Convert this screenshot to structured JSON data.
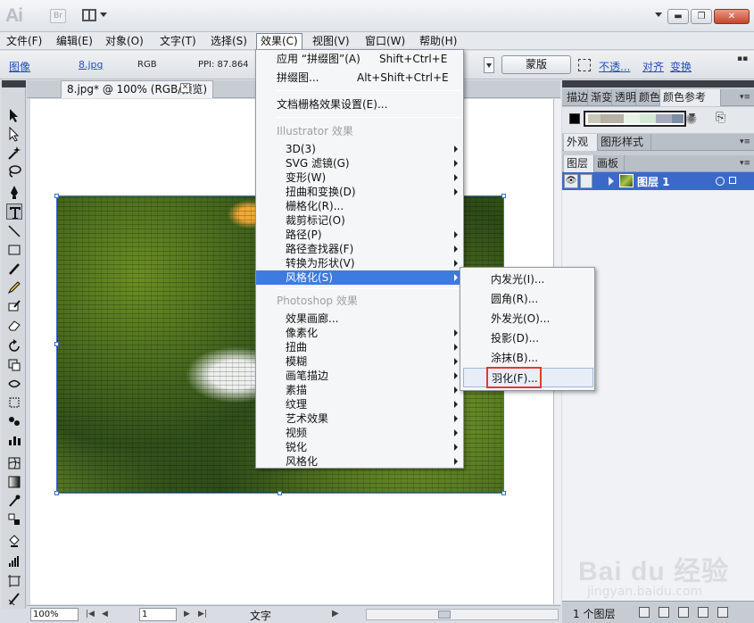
{
  "app": {
    "logo": "Ai",
    "bridge_label": "Br"
  },
  "window_controls": {
    "minimize": "▬",
    "restore": "❐",
    "close": "✕"
  },
  "menubar": {
    "items": [
      {
        "label": "文件(F)"
      },
      {
        "label": "编辑(E)"
      },
      {
        "label": "对象(O)"
      },
      {
        "label": "文字(T)"
      },
      {
        "label": "选择(S)"
      },
      {
        "label": "效果(C)"
      },
      {
        "label": "视图(V)"
      },
      {
        "label": "窗口(W)"
      },
      {
        "label": "帮助(H)"
      }
    ]
  },
  "control_bar": {
    "object_type": "图像",
    "file_link": "8.jpg",
    "color_mode": "RGB",
    "ppi": "PPI: 87.864",
    "mask_button": "蒙版",
    "opacity_link": "不透...",
    "align_link": "对齐",
    "transform_link": "变换",
    "more": "▪▪"
  },
  "document": {
    "tab_title": "8.jpg* @ 100% (RGB/预览)",
    "tab_close": "✕"
  },
  "status_bar": {
    "zoom": "100%",
    "page": "1",
    "status_text": "文字"
  },
  "effects_menu": {
    "items": [
      {
        "label": "应用 “拼缀图”(A)",
        "shortcut": "Shift+Ctrl+E"
      },
      {
        "label": "拼缀图...",
        "shortcut": "Alt+Shift+Ctrl+E"
      },
      {
        "label": "文档栅格效果设置(E)..."
      },
      {
        "label": "Illustrator 效果"
      },
      {
        "label": "3D(3)"
      },
      {
        "label": "SVG 滤镜(G)"
      },
      {
        "label": "变形(W)"
      },
      {
        "label": "扭曲和变换(D)"
      },
      {
        "label": "栅格化(R)..."
      },
      {
        "label": "裁剪标记(O)"
      },
      {
        "label": "路径(P)"
      },
      {
        "label": "路径查找器(F)"
      },
      {
        "label": "转换为形状(V)"
      },
      {
        "label": "风格化(S)"
      },
      {
        "label": "Photoshop 效果"
      },
      {
        "label": "效果画廊..."
      },
      {
        "label": "像素化"
      },
      {
        "label": "扭曲"
      },
      {
        "label": "模糊"
      },
      {
        "label": "画笔描边"
      },
      {
        "label": "素描"
      },
      {
        "label": "纹理"
      },
      {
        "label": "艺术效果"
      },
      {
        "label": "视频"
      },
      {
        "label": "锐化"
      },
      {
        "label": "风格化"
      }
    ]
  },
  "stylize_menu": {
    "items": [
      {
        "label": "内发光(I)..."
      },
      {
        "label": "圆角(R)..."
      },
      {
        "label": "外发光(O)..."
      },
      {
        "label": "投影(D)..."
      },
      {
        "label": "涂抹(B)..."
      },
      {
        "label": "羽化(F)..."
      }
    ]
  },
  "panels": {
    "top_tabs": [
      "描边",
      "渐变",
      "透明",
      "颜色",
      "颜色参考"
    ],
    "mid_tabs": [
      "外观",
      "图形样式"
    ],
    "layer_tabs": [
      "图层",
      "画板"
    ],
    "layer_row": {
      "name": "图层 1"
    },
    "layers_count": "1 个图层",
    "panel_menu": "▾≡",
    "colors": {
      "selection_blue": "#3c69c9",
      "menu_highlight": "#3d7be0",
      "callout_red": "#e23a2b"
    },
    "swatches": [
      "#c9c9b9",
      "#b7b0a6",
      "#e7f3e6",
      "#d3e9d6",
      "#a7a9bd",
      "#7c8ea6"
    ]
  },
  "watermark": {
    "main": "Bai du 经验",
    "sub": "jingyan.baidu.com"
  }
}
